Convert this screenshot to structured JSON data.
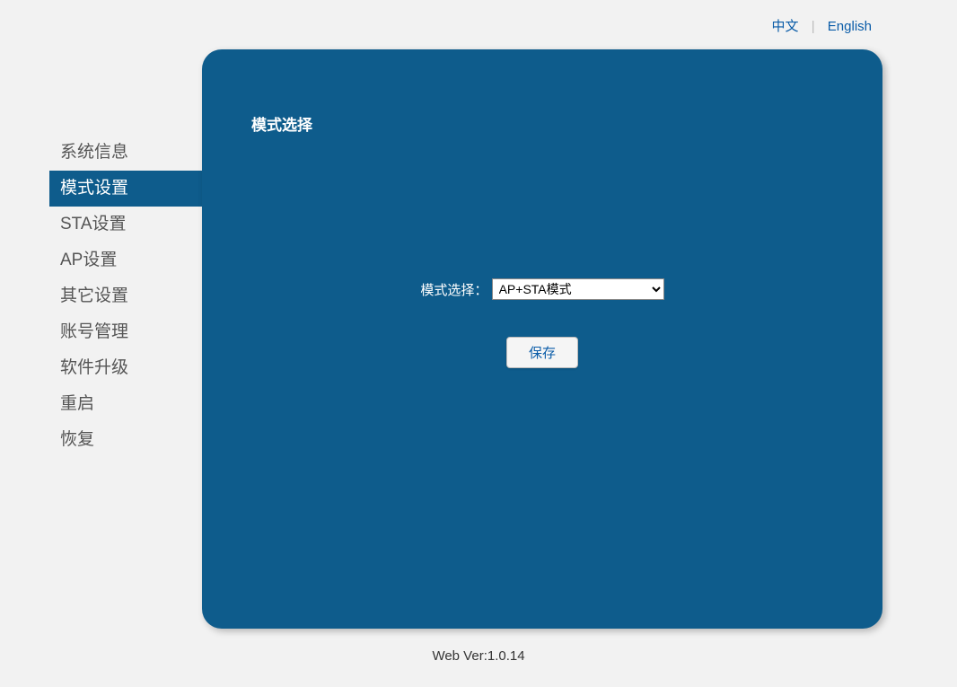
{
  "lang": {
    "chinese": "中文",
    "sep": "|",
    "english": "English"
  },
  "sidebar": {
    "items": [
      {
        "label": "系统信息"
      },
      {
        "label": "模式设置"
      },
      {
        "label": "STA设置"
      },
      {
        "label": "AP设置"
      },
      {
        "label": "其它设置"
      },
      {
        "label": "账号管理"
      },
      {
        "label": "软件升级"
      },
      {
        "label": "重启"
      },
      {
        "label": "恢复"
      }
    ],
    "activeIndex": 1
  },
  "panel": {
    "title": "模式选择",
    "modeLabel": "模式选择：",
    "modeSelected": "AP+STA模式",
    "saveLabel": "保存"
  },
  "footer": {
    "version": "Web Ver:1.0.14"
  }
}
